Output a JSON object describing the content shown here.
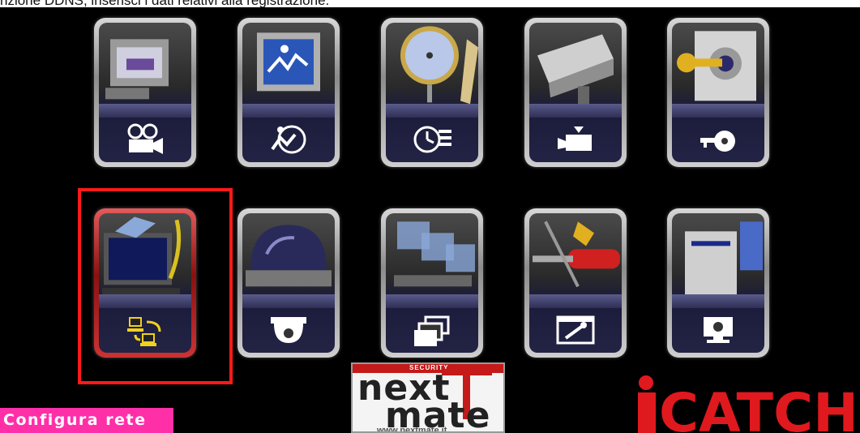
{
  "header": {
    "caption": "nzione DDNS, inserisci i dati relativi alla registrazione."
  },
  "menu": {
    "tiles": [
      {
        "name": "recording",
        "icon": "film-camera-icon"
      },
      {
        "name": "event-search",
        "icon": "motion-search-icon"
      },
      {
        "name": "schedule",
        "icon": "clock-list-icon"
      },
      {
        "name": "camera",
        "icon": "video-camera-icon"
      },
      {
        "name": "security",
        "icon": "key-lock-icon"
      },
      {
        "name": "network",
        "icon": "network-computers-icon",
        "selected": true
      },
      {
        "name": "ptz",
        "icon": "dome-camera-icon"
      },
      {
        "name": "backup",
        "icon": "folders-icon"
      },
      {
        "name": "tools",
        "icon": "wrench-window-icon"
      },
      {
        "name": "system",
        "icon": "system-monitor-icon"
      }
    ]
  },
  "status": {
    "label": "Configura rete"
  },
  "logos": {
    "nextmate": {
      "security": "SECURITY",
      "line1": "next",
      "line2": "mate",
      "url": "www.nextmate.it"
    },
    "icatch": {
      "text": "iCATCH"
    }
  },
  "colors": {
    "highlight": "#ff1a1a",
    "status_bg": "#ff2fa8",
    "logo_red": "#e0191e"
  }
}
